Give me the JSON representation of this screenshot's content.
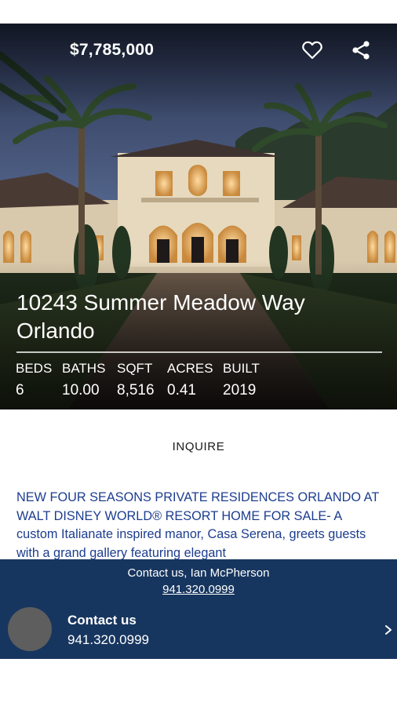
{
  "listing": {
    "price": "$7,785,000",
    "address_line1": "10243 Summer Meadow Way",
    "address_line2": "Orlando",
    "stats": [
      {
        "label": "BEDS",
        "value": "6"
      },
      {
        "label": "BATHS",
        "value": "10.00"
      },
      {
        "label": "SQFT",
        "value": "8,516"
      },
      {
        "label": "ACRES",
        "value": "0.41"
      },
      {
        "label": "BUILT",
        "value": "2019"
      }
    ],
    "inquire_label": "INQUIRE",
    "description": "NEW FOUR SEASONS PRIVATE RESIDENCES ORLANDO AT WALT DISNEY WORLD® RESORT HOME FOR SALE- A custom Italianate inspired manor, Casa Serena, greets guests with a grand gallery featuring elegant"
  },
  "contact": {
    "agent_line": "Contact us, Ian McPherson",
    "agent_phone": "941.320.0999",
    "title": "Contact us",
    "number": "941.320.0999"
  },
  "icons": {
    "favorite": "heart-outline-icon",
    "share": "share-icon",
    "chevron": "chevron-right-icon"
  },
  "colors": {
    "contact_panel": "#17365f",
    "description_text": "#1c3d8f"
  }
}
